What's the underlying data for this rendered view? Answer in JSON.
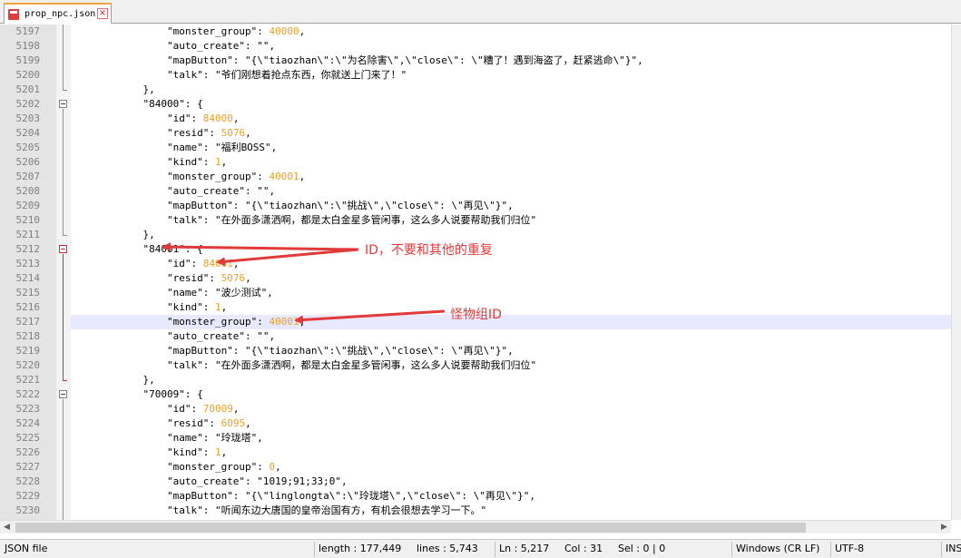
{
  "tab": {
    "label": "prop_npc.json",
    "close": "×"
  },
  "lines": [
    {
      "n": "5197",
      "parts": [
        {
          "t": "                \"monster_group\": ",
          "c": "k"
        },
        {
          "t": "40000",
          "c": "n"
        },
        {
          "t": ",",
          "c": "p"
        }
      ]
    },
    {
      "n": "5198",
      "parts": [
        {
          "t": "                \"auto_create\": \"\",",
          "c": "k"
        }
      ]
    },
    {
      "n": "5199",
      "parts": [
        {
          "t": "                \"mapButton\": \"{\\\"tiaozhan\\\":\\\"为名除害\\\",\\\"close\\\": \\\"糟了！遇到海盗了，赶紧逃命\\\"}\",",
          "c": "k"
        }
      ]
    },
    {
      "n": "5200",
      "parts": [
        {
          "t": "                \"talk\": \"爷们刚想着抢点东西，你就送上门来了！\"",
          "c": "k"
        }
      ]
    },
    {
      "n": "5201",
      "parts": [
        {
          "t": "            },",
          "c": "p"
        }
      ]
    },
    {
      "n": "5202",
      "parts": [
        {
          "t": "            \"84000\": {",
          "c": "k"
        }
      ]
    },
    {
      "n": "5203",
      "parts": [
        {
          "t": "                \"id\": ",
          "c": "k"
        },
        {
          "t": "84000",
          "c": "n"
        },
        {
          "t": ",",
          "c": "p"
        }
      ]
    },
    {
      "n": "5204",
      "parts": [
        {
          "t": "                \"resid\": ",
          "c": "k"
        },
        {
          "t": "5076",
          "c": "n"
        },
        {
          "t": ",",
          "c": "p"
        }
      ]
    },
    {
      "n": "5205",
      "parts": [
        {
          "t": "                \"name\": \"福利BOSS\",",
          "c": "k"
        }
      ]
    },
    {
      "n": "5206",
      "parts": [
        {
          "t": "                \"kind\": ",
          "c": "k"
        },
        {
          "t": "1",
          "c": "n"
        },
        {
          "t": ",",
          "c": "p"
        }
      ]
    },
    {
      "n": "5207",
      "parts": [
        {
          "t": "                \"monster_group\": ",
          "c": "k"
        },
        {
          "t": "40001",
          "c": "n"
        },
        {
          "t": ",",
          "c": "p"
        }
      ]
    },
    {
      "n": "5208",
      "parts": [
        {
          "t": "                \"auto_create\": \"\",",
          "c": "k"
        }
      ]
    },
    {
      "n": "5209",
      "parts": [
        {
          "t": "                \"mapButton\": \"{\\\"tiaozhan\\\":\\\"挑战\\\",\\\"close\\\": \\\"再见\\\"}\",",
          "c": "k"
        }
      ]
    },
    {
      "n": "5210",
      "parts": [
        {
          "t": "                \"talk\": \"在外面多潇洒啊，都是太白金星多管闲事，这么多人说要帮助我们归位\"",
          "c": "k"
        }
      ]
    },
    {
      "n": "5211",
      "parts": [
        {
          "t": "            },",
          "c": "p"
        }
      ]
    },
    {
      "n": "5212",
      "parts": [
        {
          "t": "            \"84001\": {",
          "c": "k"
        }
      ]
    },
    {
      "n": "5213",
      "parts": [
        {
          "t": "                \"id\": ",
          "c": "k"
        },
        {
          "t": "84001",
          "c": "n"
        },
        {
          "t": ",",
          "c": "p"
        }
      ]
    },
    {
      "n": "5214",
      "parts": [
        {
          "t": "                \"resid\": ",
          "c": "k"
        },
        {
          "t": "5076",
          "c": "n"
        },
        {
          "t": ",",
          "c": "p"
        }
      ]
    },
    {
      "n": "5215",
      "parts": [
        {
          "t": "                \"name\": \"波少测试\",",
          "c": "k"
        }
      ]
    },
    {
      "n": "5216",
      "parts": [
        {
          "t": "                \"kind\": ",
          "c": "k"
        },
        {
          "t": "1",
          "c": "n"
        },
        {
          "t": ",",
          "c": "p"
        }
      ]
    },
    {
      "n": "5217",
      "parts": [
        {
          "t": "                \"monster_group\": ",
          "c": "k"
        },
        {
          "t": "40001",
          "c": "n"
        },
        {
          "t": ",",
          "c": "p"
        }
      ]
    },
    {
      "n": "5218",
      "parts": [
        {
          "t": "                \"auto_create\": \"\",",
          "c": "k"
        }
      ]
    },
    {
      "n": "5219",
      "parts": [
        {
          "t": "                \"mapButton\": \"{\\\"tiaozhan\\\":\\\"挑战\\\",\\\"close\\\": \\\"再见\\\"}\",",
          "c": "k"
        }
      ]
    },
    {
      "n": "5220",
      "parts": [
        {
          "t": "                \"talk\": \"在外面多潇洒啊，都是太白金星多管闲事，这么多人说要帮助我们归位\"",
          "c": "k"
        }
      ]
    },
    {
      "n": "5221",
      "parts": [
        {
          "t": "            },",
          "c": "p"
        }
      ]
    },
    {
      "n": "5222",
      "parts": [
        {
          "t": "            \"70009\": {",
          "c": "k"
        }
      ]
    },
    {
      "n": "5223",
      "parts": [
        {
          "t": "                \"id\": ",
          "c": "k"
        },
        {
          "t": "70009",
          "c": "n"
        },
        {
          "t": ",",
          "c": "p"
        }
      ]
    },
    {
      "n": "5224",
      "parts": [
        {
          "t": "                \"resid\": ",
          "c": "k"
        },
        {
          "t": "6095",
          "c": "n"
        },
        {
          "t": ",",
          "c": "p"
        }
      ]
    },
    {
      "n": "5225",
      "parts": [
        {
          "t": "                \"name\": \"玲珑塔\",",
          "c": "k"
        }
      ]
    },
    {
      "n": "5226",
      "parts": [
        {
          "t": "                \"kind\": ",
          "c": "k"
        },
        {
          "t": "1",
          "c": "n"
        },
        {
          "t": ",",
          "c": "p"
        }
      ]
    },
    {
      "n": "5227",
      "parts": [
        {
          "t": "                \"monster_group\": ",
          "c": "k"
        },
        {
          "t": "0",
          "c": "n"
        },
        {
          "t": ",",
          "c": "p"
        }
      ]
    },
    {
      "n": "5228",
      "parts": [
        {
          "t": "                \"auto_create\": \"1019;91;33;0\",",
          "c": "k"
        }
      ]
    },
    {
      "n": "5229",
      "parts": [
        {
          "t": "                \"mapButton\": \"{\\\"linglongta\\\":\\\"玲珑塔\\\",\\\"close\\\": \\\"再见\\\"}\",",
          "c": "k"
        }
      ]
    },
    {
      "n": "5230",
      "parts": [
        {
          "t": "                \"talk\": \"听闻东边大唐国的皇帝治国有方，有机会很想去学习一下。\"",
          "c": "k"
        }
      ]
    }
  ],
  "current_line": "5217",
  "annotations": {
    "id_note": "ID，不要和其他的重复",
    "group_note": "怪物组ID"
  },
  "colors": {
    "accent_tab": "#f4a23a",
    "number": "#e8a02a",
    "annotation": "#e03a3a",
    "current_line": "#e8e8ff"
  },
  "status": {
    "file_type": "JSON file",
    "length": "length : 177,449",
    "lines": "lines : 5,743",
    "ln": "Ln : 5,217",
    "col": "Col : 31",
    "sel": "Sel : 0 | 0",
    "eol": "Windows (CR LF)",
    "encoding": "UTF-8",
    "ins": "INS"
  }
}
